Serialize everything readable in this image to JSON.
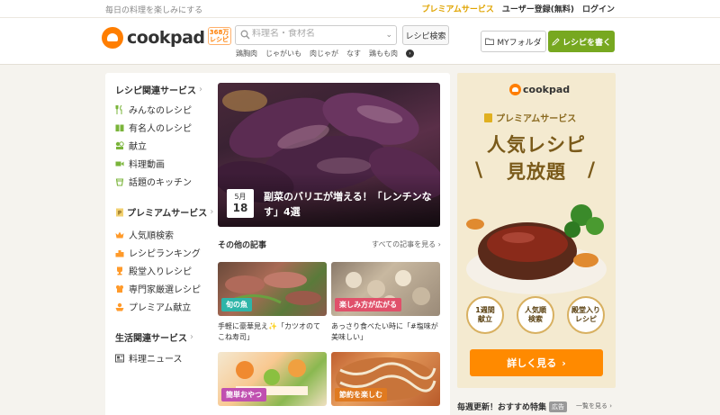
{
  "topbar": {
    "tagline": "毎日の料理を楽しみにする",
    "premium": "プレミアムサービス",
    "register": "ユーザー登録(無料)",
    "login": "ログイン"
  },
  "header": {
    "logo_text": "cookpad",
    "logo_badge_line1": "368万",
    "logo_badge_line2": "レシピ",
    "search_placeholder": "料理名・食材名",
    "search_button": "レシピ検索",
    "suggestions": [
      "鶏胸肉",
      "じゃがいも",
      "肉じゃが",
      "なす",
      "鶏もも肉"
    ],
    "myfolder": "MYフォルダ",
    "write_recipe": "レシピを書く"
  },
  "sidebar": {
    "recipe_services_title": "レシピ関連サービス",
    "recipe_services": [
      {
        "label": "みんなのレシピ",
        "icon": "utensils-icon"
      },
      {
        "label": "有名人のレシピ",
        "icon": "book-icon"
      },
      {
        "label": "献立",
        "icon": "menu-plan-icon"
      },
      {
        "label": "料理動画",
        "icon": "video-icon"
      },
      {
        "label": "話題のキッチン",
        "icon": "cup-icon"
      }
    ],
    "premium_title": "プレミアムサービス",
    "premium_services": [
      {
        "label": "人気順検索",
        "icon": "crown-icon"
      },
      {
        "label": "レシピランキング",
        "icon": "ranking-icon"
      },
      {
        "label": "殿堂入りレシピ",
        "icon": "trophy-icon"
      },
      {
        "label": "専門家厳選レシピ",
        "icon": "chef-icon"
      },
      {
        "label": "プレミアム献立",
        "icon": "premium-menu-icon"
      }
    ],
    "life_title": "生活関連サービス",
    "life_services": [
      {
        "label": "料理ニュース",
        "icon": "news-icon"
      }
    ]
  },
  "feature": {
    "month": "5月",
    "day": "18",
    "title": "副菜のバリエが増える！「レンチンなす」4選"
  },
  "articles": {
    "title": "その他の記事",
    "see_all": "すべての記事を見る",
    "items": [
      {
        "tag": "旬の魚",
        "caption": "手軽に豪華見え✨「カツオのてこね寿司」",
        "tag_color": "#2eb5a8"
      },
      {
        "tag": "楽しみ方が広がる",
        "caption": "あっさり食べたい時に「#塩味が美味しい」",
        "tag_color": "#e0506a"
      },
      {
        "tag": "簡単おやつ",
        "caption": "",
        "tag_color": "#c050b0"
      },
      {
        "tag": "節約を楽しむ",
        "caption": "",
        "tag_color": "#e07a20"
      }
    ]
  },
  "ad": {
    "logo": "cookpad",
    "premium": "プレミアムサービス",
    "headline1": "人気レシピ",
    "headline2": "見放題",
    "features": [
      "1週間\n献立",
      "人気順\n検索",
      "殿堂入り\nレシピ"
    ],
    "cta": "詳しく見る"
  },
  "weekly": {
    "title": "毎週更新！おすすめ特集",
    "ad_tag": "広告",
    "link": "一覧を見る"
  }
}
